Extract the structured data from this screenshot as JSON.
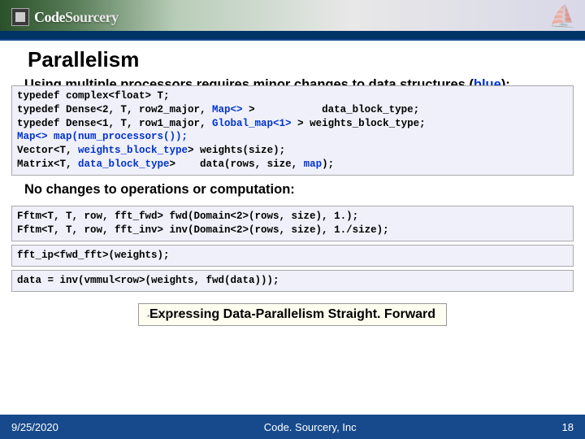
{
  "header": {
    "brand_part1": "Code",
    "brand_part2": "Sourcery"
  },
  "title": "Parallelism",
  "intro": {
    "pre": "Using multiple processors requires minor changes to data structures (",
    "blue": "blue",
    "post": "):"
  },
  "code1": {
    "l1a": "typedef complex<float> T;",
    "l2a": "typedef Dense<2, T, row2_major, ",
    "l2b": "Map<>",
    "l2c": " >           data_block_type;",
    "l3a": "typedef Dense<1, T, row1_major, ",
    "l3b": "Global_map<1>",
    "l3c": " > weights_block_type;",
    "l4": "Map<> map(num_processors());",
    "l5a": "Vector<T, ",
    "l5b": "weights_block_type",
    "l5c": "> weights(size);",
    "l6a": "Matrix<T, ",
    "l6b": "data_block_type",
    "l6c": ">    data(rows, size, ",
    "l6d": "map",
    "l6e": ");"
  },
  "subtitle": "No changes to operations or computation:",
  "code2": {
    "l1": "Fftm<T, T, row, fft_fwd> fwd(Domain<2>(rows, size), 1.);",
    "l2": "Fftm<T, T, row, fft_inv> inv(Domain<2>(rows, size), 1./size);"
  },
  "code3": {
    "l1": "fft_ip<fwd_fft>(weights);"
  },
  "code4": {
    "l1": "data = inv(vmmul<row>(weights, fwd(data)));"
  },
  "callout": "Expressing Data-Parallelism Straight. Forward",
  "footer": {
    "date": "9/25/2020",
    "org": "Code. Sourcery, Inc",
    "page": "18"
  }
}
